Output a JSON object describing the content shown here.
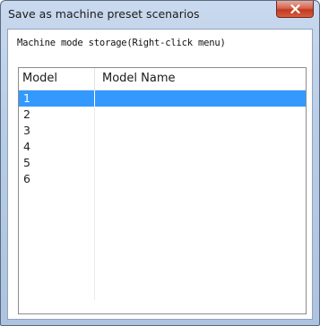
{
  "window": {
    "title": "Save as machine preset scenarios",
    "close_glyph": "x",
    "close_icon": "close-icon"
  },
  "group": {
    "label": "Machine mode storage(Right-click menu)"
  },
  "table": {
    "columns": [
      "Model",
      "Model Name"
    ],
    "rows": [
      {
        "model": "1",
        "name": "",
        "selected": true
      },
      {
        "model": "2",
        "name": "",
        "selected": false
      },
      {
        "model": "3",
        "name": "",
        "selected": false
      },
      {
        "model": "4",
        "name": "",
        "selected": false
      },
      {
        "model": "5",
        "name": "",
        "selected": false
      },
      {
        "model": "6",
        "name": "",
        "selected": false
      },
      {
        "model": "",
        "name": "",
        "selected": false
      },
      {
        "model": "",
        "name": "",
        "selected": false
      },
      {
        "model": "",
        "name": "",
        "selected": false
      },
      {
        "model": "",
        "name": "",
        "selected": false
      },
      {
        "model": "",
        "name": "",
        "selected": false
      },
      {
        "model": "",
        "name": "",
        "selected": false
      },
      {
        "model": "",
        "name": "",
        "selected": false
      }
    ]
  },
  "colors": {
    "selection": "#3399ff",
    "close_button": "#c23a22"
  }
}
